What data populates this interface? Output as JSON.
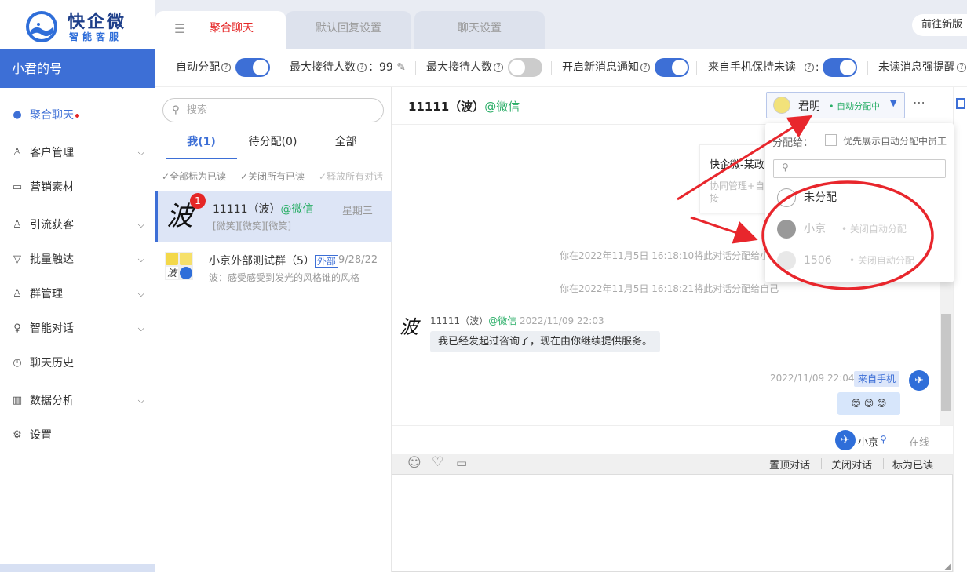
{
  "brand": {
    "name": "快企微",
    "tagline": "智能客服"
  },
  "account": {
    "name": "小君的号"
  },
  "nav": [
    {
      "label": "聚合聊天",
      "icon": "wechat-icon",
      "active": true,
      "dot": true
    },
    {
      "label": "客户管理",
      "icon": "customers-icon",
      "chevron": true
    },
    {
      "label": "营销素材",
      "icon": "folder-icon"
    },
    {
      "label": "引流获客",
      "icon": "user-add-icon",
      "chevron": true
    },
    {
      "label": "批量触达",
      "icon": "filter-icon",
      "chevron": true
    },
    {
      "label": "群管理",
      "icon": "group-icon",
      "chevron": true
    },
    {
      "label": "智能对话",
      "icon": "bulb-icon",
      "chevron": true
    },
    {
      "label": "聊天历史",
      "icon": "history-icon"
    },
    {
      "label": "数据分析",
      "icon": "bar-chart-icon",
      "chevron": true
    },
    {
      "label": "设置",
      "icon": "gear-icon"
    }
  ],
  "tabs": [
    "聚合聊天",
    "默认回复设置",
    "聊天设置"
  ],
  "goto_label": "前往新版",
  "settings": {
    "auto_assign": "自动分配",
    "max_wait": "最大接待人数",
    "max_wait_value": "：99",
    "max_wait2": "最大接待人数",
    "new_msg_notify": "开启新消息通知",
    "keep_unread": "来自手机保持未读",
    "colon": ":",
    "unread_remind": "未读消息强提醒"
  },
  "search": {
    "placeholder": "搜索"
  },
  "list_tabs": [
    "我(1)",
    "待分配(0)",
    "全部"
  ],
  "bulk": [
    "✓全部标为已读",
    "✓关闭所有已读",
    "✓释放所有对话"
  ],
  "conversations": [
    {
      "name": "11111（波）",
      "source": "@微信",
      "time": "星期三",
      "preview": "[微笑][微笑][微笑]",
      "badge": "1",
      "avatar_char": "波"
    },
    {
      "name": "小京外部测试群（5）",
      "tag": "外部",
      "time": "9/28/22",
      "preview": "波：感受感受到发光的风格谁的风格"
    }
  ],
  "chat": {
    "title": "11111（波）",
    "source": "@微信",
    "assignee": "君明",
    "assignee_status": "• 自动分配中",
    "card_title": "快企微-某政",
    "card_desc": "协同管理+自\n接",
    "sys1": "你在2022年11月5日 16:18:10将此对话分配给小京",
    "sys2": "你在2022年11月5日 16:18:21将此对话分配给自己",
    "msg1": {
      "sender": "11111（波）",
      "source": "@微信",
      "time": "2022/11/09 22:03",
      "text": "我已经发起过咨询了，现在由你继续提供服务。",
      "avatar_char": "波"
    },
    "msg2": {
      "time": "2022/11/09 22:04",
      "tag": "来自手机",
      "text": "😊 😊 😊"
    },
    "agent": "小京",
    "agent_status": "在线",
    "actions": [
      "置顶对话",
      "关闭对话",
      "标为已读"
    ]
  },
  "dropdown": {
    "assign_to": "分配给：",
    "prefer_label": "优先展示自动分配中员工",
    "options": [
      {
        "name": "未分配"
      },
      {
        "name": "小京",
        "status": "• 关闭自动分配"
      },
      {
        "name": "1506",
        "status": "• 关闭自动分配"
      }
    ]
  },
  "colors": {
    "accent": "#3d6fd6",
    "danger": "#e52626",
    "wechat": "#2aae67",
    "annotation": "#e8262c"
  }
}
